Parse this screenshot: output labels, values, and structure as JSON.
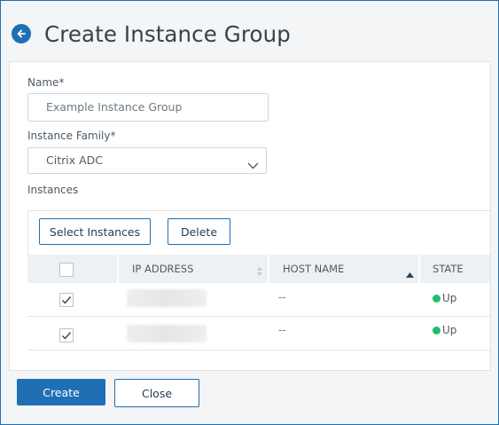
{
  "header": {
    "back_icon": "arrow-left-circle-icon",
    "title": "Create Instance Group"
  },
  "form": {
    "name_label": "Name*",
    "name_placeholder": "Example Instance Group",
    "family_label": "Instance Family*",
    "family_value": "Citrix ADC",
    "instances_label": "Instances"
  },
  "grid": {
    "toolbar": {
      "select_label": "Select Instances",
      "delete_label": "Delete"
    },
    "columns": [
      "IP ADDRESS",
      "HOST NAME",
      "STATE"
    ],
    "rows": [
      {
        "checked": true,
        "ip": "",
        "host": "--",
        "state": "Up"
      },
      {
        "checked": true,
        "ip": "",
        "host": "--",
        "state": "Up"
      }
    ]
  },
  "footer": {
    "create_label": "Create",
    "close_label": "Close"
  },
  "colors": {
    "accent": "#1f6fb5",
    "status_up": "#1fbf6e"
  }
}
